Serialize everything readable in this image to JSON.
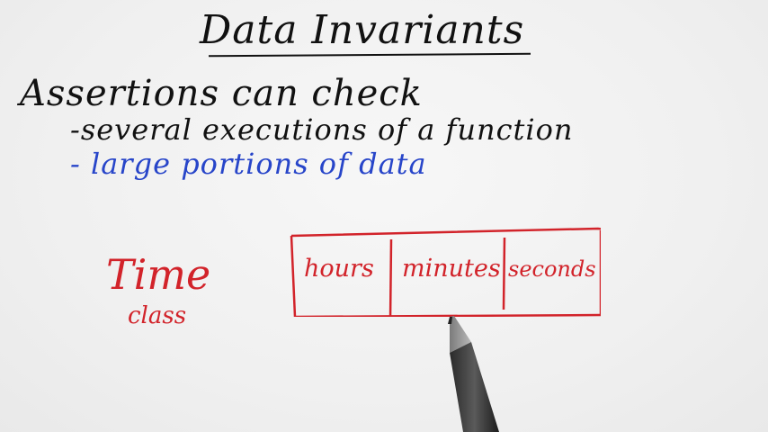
{
  "board": {
    "title": "Data Invariants",
    "lines": [
      "Assertions can check",
      "-several executions of a function",
      "- large portions of data"
    ],
    "time_label": "Time",
    "class_label": "class",
    "fields": [
      "hours",
      "minutes",
      "seconds"
    ]
  },
  "colors": {
    "ink_black": "#111111",
    "ink_blue": "#2745c9",
    "ink_red": "#d2232a",
    "background": "#f2f2f2"
  },
  "icons": {
    "pencil": "pencil-icon"
  }
}
